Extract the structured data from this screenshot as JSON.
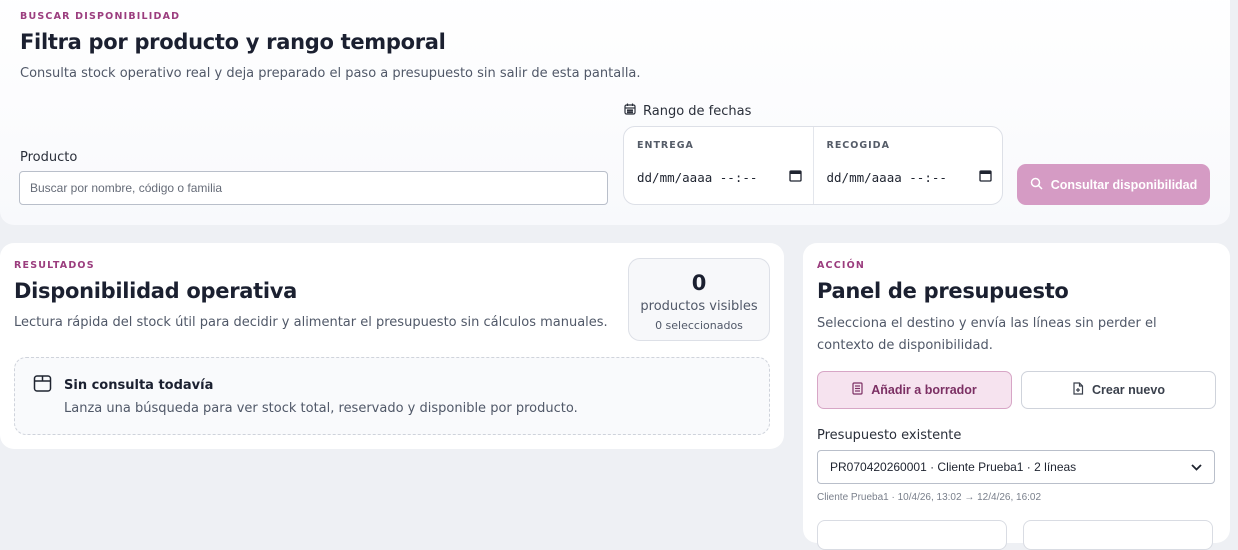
{
  "search": {
    "eyebrow": "BUSCAR DISPONIBILIDAD",
    "title": "Filtra por producto y rango temporal",
    "description": "Consulta stock operativo real y deja preparado el paso a presupuesto sin salir de esta pantalla.",
    "product_label": "Producto",
    "product_placeholder": "Buscar por nombre, código o familia",
    "range_label": "Rango de fechas",
    "delivery_label": "ENTREGA",
    "delivery_value": "dd/mm/aaaa --:--",
    "pickup_label": "RECOGIDA",
    "pickup_value": "dd/mm/aaaa --:--",
    "consult_button": "Consultar disponibilidad"
  },
  "results": {
    "eyebrow": "RESULTADOS",
    "title": "Disponibilidad operativa",
    "description": "Lectura rápida del stock útil para decidir y alimentar el presupuesto sin cálculos manuales.",
    "counter_value": "0",
    "counter_label": "productos visibles",
    "counter_selected": "0 seleccionados",
    "empty_title": "Sin consulta todavía",
    "empty_description": "Lanza una búsqueda para ver stock total, reservado y disponible por producto."
  },
  "action": {
    "eyebrow": "ACCIÓN",
    "title": "Panel de presupuesto",
    "description": "Selecciona el destino y envía las líneas sin perder el contexto de disponibilidad.",
    "add_draft_button": "Añadir a borrador",
    "create_new_button": "Crear nuevo",
    "existing_label": "Presupuesto existente",
    "existing_selected": "PR070420260001 · Cliente Prueba1 · 2 líneas",
    "existing_meta": "Cliente Prueba1 · 10/4/26, 13:02 → 12/4/26, 16:02"
  },
  "colors": {
    "accent": "#9b3d7e",
    "primary_button": "#d59bc4",
    "selected_button_bg": "#f6e3ef"
  }
}
